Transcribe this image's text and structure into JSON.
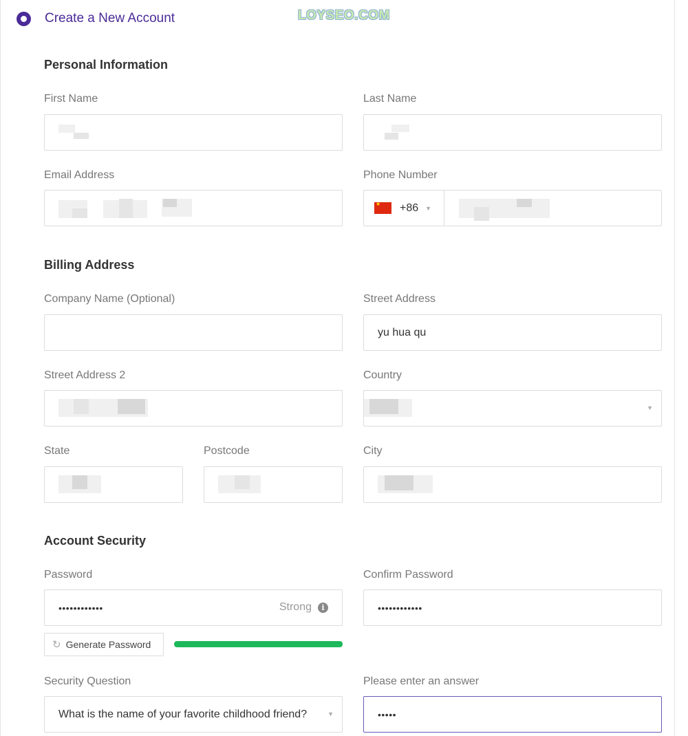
{
  "header": {
    "step_title": "Create a New Account",
    "watermark": "LOYSEO.COM"
  },
  "sections": {
    "personal": "Personal Information",
    "billing": "Billing Address",
    "security": "Account Security"
  },
  "fields": {
    "first_name": {
      "label": "First Name"
    },
    "last_name": {
      "label": "Last Name"
    },
    "email": {
      "label": "Email Address"
    },
    "phone": {
      "label": "Phone Number",
      "dial_code": "+86",
      "flag": "china-flag-icon"
    },
    "company": {
      "label": "Company Name (Optional)",
      "value": ""
    },
    "street": {
      "label": "Street Address",
      "value": "yu hua qu"
    },
    "street2": {
      "label": "Street Address 2"
    },
    "country": {
      "label": "Country"
    },
    "state": {
      "label": "State"
    },
    "postcode": {
      "label": "Postcode"
    },
    "city": {
      "label": "City"
    },
    "password": {
      "label": "Password",
      "value": "••••••••••••",
      "strength": "Strong"
    },
    "confirm_password": {
      "label": "Confirm Password",
      "value": "••••••••••••"
    },
    "security_question": {
      "label": "Security Question",
      "value": "What is the name of your favorite childhood friend?"
    },
    "answer": {
      "label": "Please enter an answer",
      "value": "•••••"
    }
  },
  "generate_password_label": "Generate Password",
  "password_strength_fraction": 1.0,
  "colors": {
    "accent": "#4a2b97",
    "strength": "#1cb85c",
    "focus_border": "#6b57b8"
  }
}
